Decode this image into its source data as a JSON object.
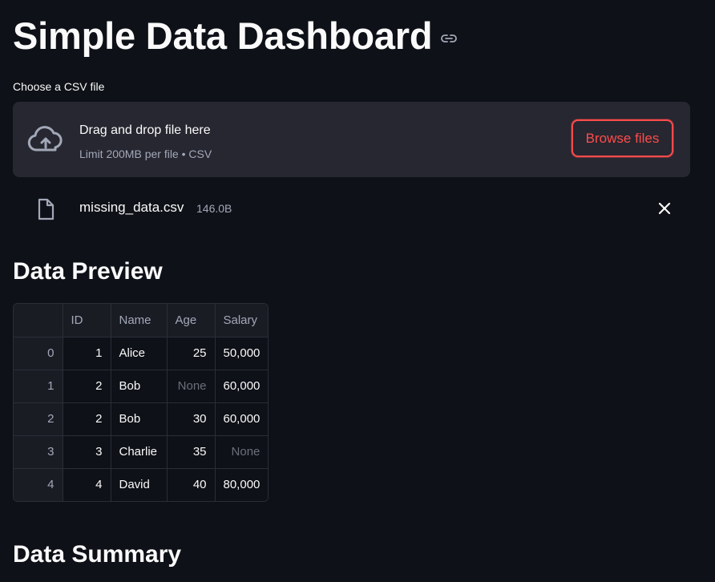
{
  "page": {
    "title": "Simple Data Dashboard"
  },
  "uploader": {
    "label": "Choose a CSV file",
    "drop_text": "Drag and drop file here",
    "limit_text": "Limit 200MB per file • CSV",
    "browse_label": "Browse files",
    "accent_color": "#ff4b4b"
  },
  "uploaded_file": {
    "name": "missing_data.csv",
    "size": "146.0B"
  },
  "preview": {
    "heading": "Data Preview",
    "columns": [
      "",
      "ID",
      "Name",
      "Age",
      "Salary"
    ],
    "rows": [
      {
        "index": "0",
        "ID": "1",
        "Name": "Alice",
        "Age": "25",
        "Salary": "50,000"
      },
      {
        "index": "1",
        "ID": "2",
        "Name": "Bob",
        "Age": "None",
        "Salary": "60,000"
      },
      {
        "index": "2",
        "ID": "2",
        "Name": "Bob",
        "Age": "30",
        "Salary": "60,000"
      },
      {
        "index": "3",
        "ID": "3",
        "Name": "Charlie",
        "Age": "35",
        "Salary": "None"
      },
      {
        "index": "4",
        "ID": "4",
        "Name": "David",
        "Age": "40",
        "Salary": "80,000"
      }
    ]
  },
  "summary": {
    "heading": "Data Summary"
  },
  "icons": {
    "anchor": "link-icon",
    "upload": "cloud-upload-icon",
    "file": "file-icon",
    "remove": "close-icon"
  }
}
